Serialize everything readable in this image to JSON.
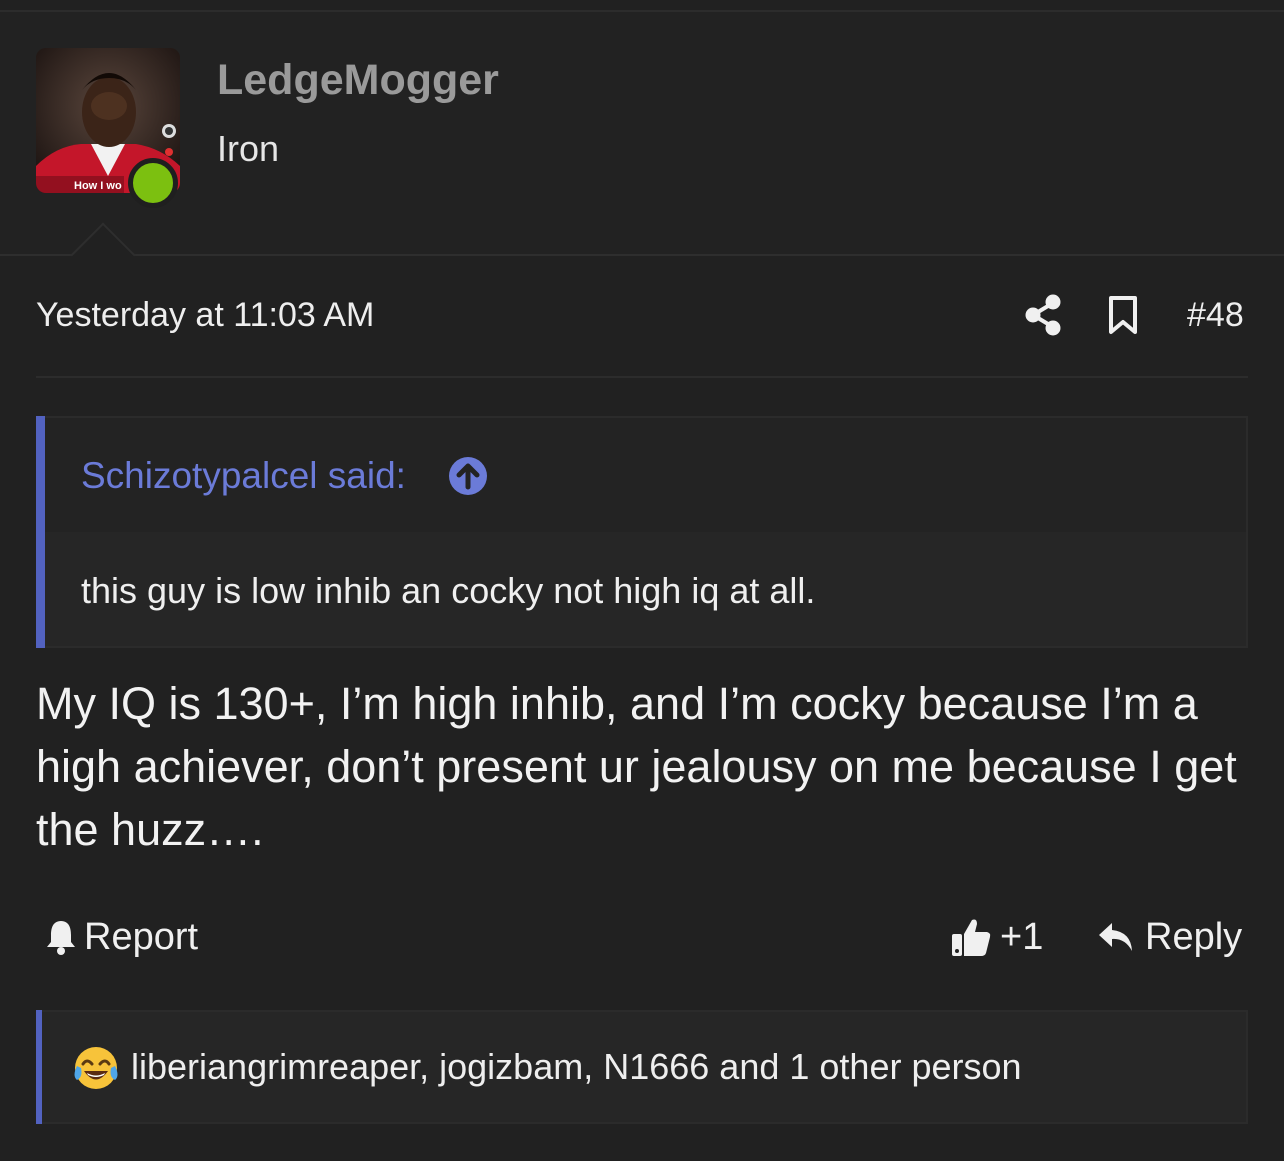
{
  "user": {
    "name": "LedgeMogger",
    "rank": "Iron",
    "avatar_caption": "How I wo",
    "online_color": "#7cc010"
  },
  "post": {
    "timestamp": "Yesterday at 11:03 AM",
    "number": "#48",
    "icons": [
      "share-icon",
      "bookmark-icon"
    ]
  },
  "quote": {
    "author": "Schizotypalcel said:",
    "text": "this guy is low inhib an cocky not high iq at all.",
    "accent": "#5262c0"
  },
  "message": "My IQ is 130+, I’m high inhib, and I’m cocky because I’m a high achiever, don’t present ur jealousy on me because I get the huzz….",
  "actions": {
    "report": "Report",
    "like": "+1",
    "reply": "Reply"
  },
  "reactions": {
    "emoji": "joy-tears-icon",
    "text": "liberiangrimreaper, jogizbam, N1666 and 1 other person"
  }
}
